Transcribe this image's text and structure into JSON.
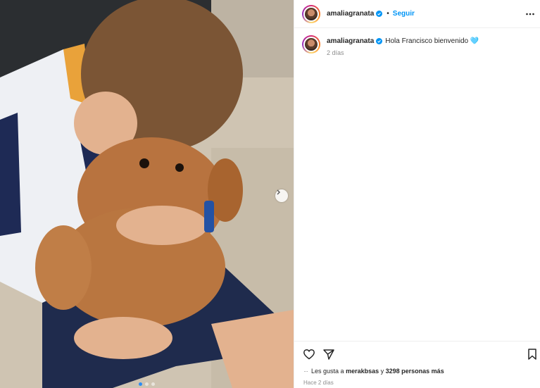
{
  "post": {
    "username": "amaliagranata",
    "separator": "•",
    "follow_label": "Seguir",
    "caption_text": "Hola Francisco bienvenido 🩵",
    "caption_time": "2 días",
    "likes_prefix": "Les gusta a",
    "likes_user": "merakbsas",
    "likes_middle": "y",
    "likes_count": "3298 personas más",
    "posted_ago": "Hace 2 días",
    "carousel": {
      "total": 3,
      "active": 1
    }
  },
  "icons": {
    "verified": "verified-badge-icon",
    "more": "more-options-icon",
    "like": "heart-icon",
    "share": "send-icon",
    "save": "bookmark-icon",
    "next": "chevron-right-icon"
  },
  "colors": {
    "accent": "#0095f6",
    "muted": "#8e8e8e",
    "text": "#262626",
    "active_dot": "#2b8cf5"
  }
}
